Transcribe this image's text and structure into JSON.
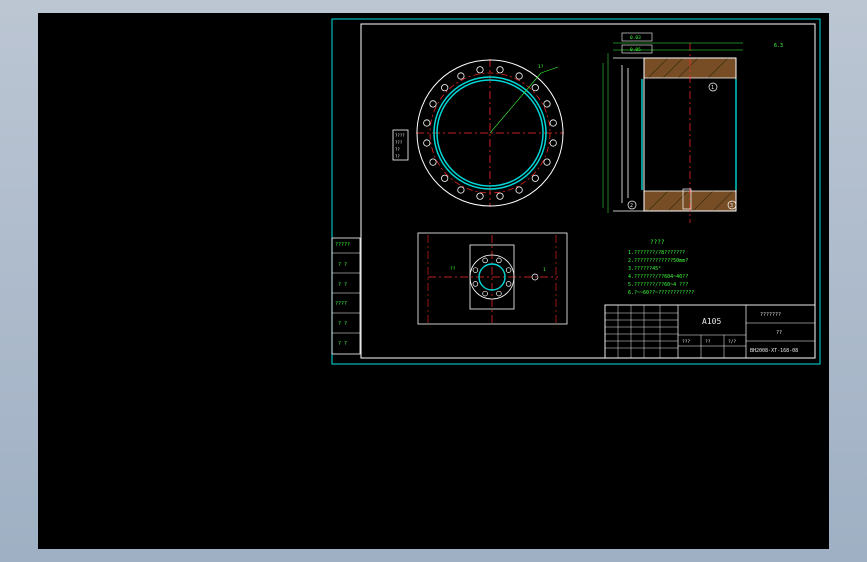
{
  "colors": {
    "background": "#000000",
    "frame": "#00e0e0",
    "outline": "#ffffff",
    "centerline": "#ff2a2a",
    "dimension": "#3cff3c",
    "hatch": "#8b5a2b"
  },
  "top_view": {
    "leader_label": "1?",
    "side_note": [
      "????",
      "???",
      "??",
      "??"
    ]
  },
  "section_view": {
    "tol_box_1": "0.03",
    "tol_box_2": "0.05",
    "balloon_1": "1",
    "balloon_2": "2",
    "balloon_3": "3"
  },
  "small_view": {
    "label_left": "??",
    "label_right": "1"
  },
  "tech_requirements": {
    "title": "????",
    "lines": [
      "1.???????/?8???????",
      "2.?????????????50mm?",
      "3.??????45°",
      "4.???????/??604~40??",
      "5.???????/??60~4 ???",
      "6.?~~60??~????????????"
    ]
  },
  "left_strip": {
    "cells": [
      "?????",
      "? ?",
      "? ?",
      "????",
      "? ?",
      "? ?"
    ]
  },
  "title_block": {
    "material": "A105",
    "part_name": "???????",
    "scale": "??",
    "drawing_no": "BH2008-XT-168-08",
    "sheet_info": [
      "???",
      "??",
      "?/?"
    ]
  },
  "roughness": "6.3"
}
